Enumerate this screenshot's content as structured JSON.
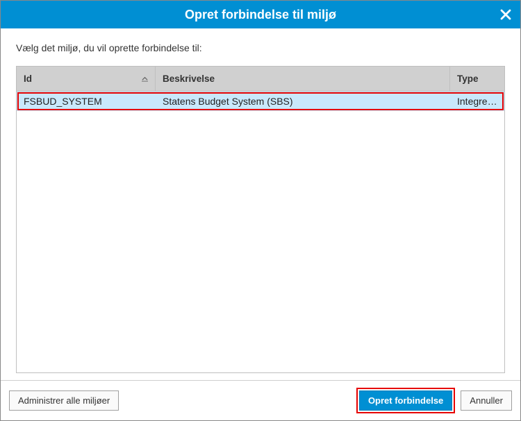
{
  "dialog": {
    "title": "Opret forbindelse til miljø",
    "instruction": "Vælg det miljø, du vil oprette forbindelse til:"
  },
  "table": {
    "columns": {
      "id": "Id",
      "description": "Beskrivelse",
      "type": "Type"
    },
    "rows": [
      {
        "id": "FSBUD_SYSTEM",
        "description": "Statens Budget System (SBS)",
        "type": "Integre…"
      }
    ]
  },
  "buttons": {
    "manage": "Administrer alle miljøer",
    "connect": "Opret forbindelse",
    "cancel": "Annuller"
  }
}
